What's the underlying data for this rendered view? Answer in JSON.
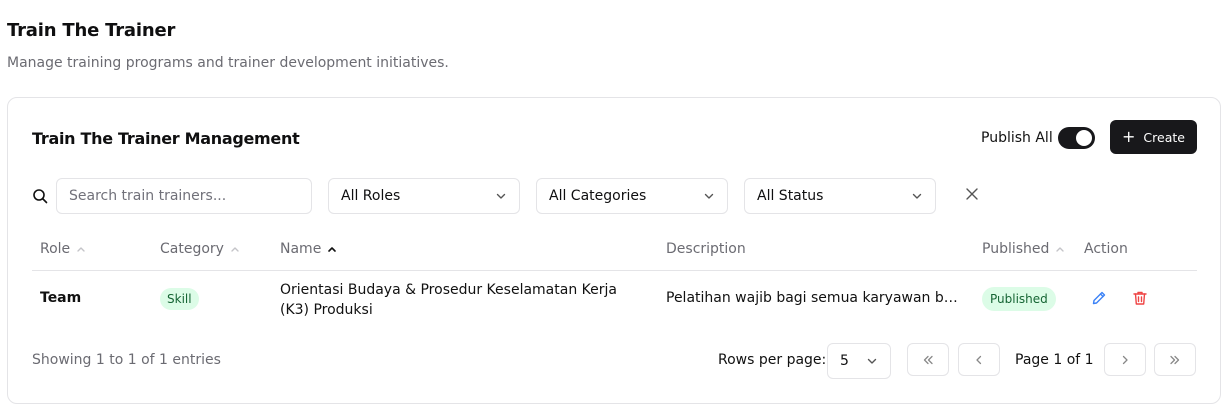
{
  "page": {
    "title": "Train The Trainer",
    "subtitle": "Manage training programs and trainer development initiatives."
  },
  "card": {
    "title": "Train The Trainer Management",
    "publish_all_label": "Publish All",
    "publish_all_on": true,
    "create_label": "Create"
  },
  "filters": {
    "search_placeholder": "Search train trainers...",
    "roles": "All Roles",
    "categories": "All Categories",
    "status": "All Status"
  },
  "table": {
    "columns": [
      "Role",
      "Category",
      "Name",
      "Description",
      "Published",
      "Action"
    ],
    "rows": [
      {
        "role": "Team",
        "category": "Skill",
        "name": "Orientasi Budaya & Prosedur Keselamatan Kerja (K3) Produksi",
        "description": "Pelatihan wajib bagi semua karyawan baru ...",
        "published": "Published"
      }
    ]
  },
  "footer": {
    "showing": "Showing 1 to 1 of 1 entries",
    "rows_per_page_label": "Rows per page:",
    "rows_per_page": "5",
    "page_info": "Page 1 of 1"
  },
  "colors": {
    "primary": "#18181b",
    "badge_bg": "#dcfce7",
    "badge_text": "#166534",
    "edit": "#3b82f6",
    "delete": "#ef4444"
  }
}
